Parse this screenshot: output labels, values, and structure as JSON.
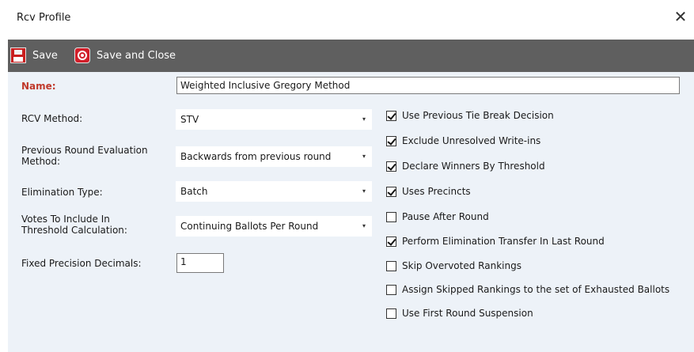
{
  "window": {
    "title": "Rcv Profile",
    "close_glyph": "✕"
  },
  "toolbar": {
    "save_label": "Save",
    "save_close_label": "Save and Close"
  },
  "form": {
    "name_label": "Name:",
    "name_value": "Weighted Inclusive Gregory Method",
    "rcv_method_label": "RCV Method:",
    "rcv_method_value": "STV",
    "prev_round_label_1": "Previous Round Evaluation",
    "prev_round_label_2": "Method:",
    "prev_round_value": "Backwards from previous round",
    "elimination_type_label": "Elimination Type:",
    "elimination_type_value": "Batch",
    "votes_label_1": "Votes To Include In",
    "votes_label_2": "Threshold Calculation:",
    "votes_value": "Continuing Ballots Per Round",
    "precision_label": "Fixed Precision Decimals:",
    "precision_value": "1"
  },
  "options": [
    {
      "label": "Use Previous Tie Break Decision",
      "checked": true
    },
    {
      "label": "Exclude Unresolved Write-ins",
      "checked": true
    },
    {
      "label": "Declare Winners By Threshold",
      "checked": true
    },
    {
      "label": "Uses Precincts",
      "checked": true
    },
    {
      "label": "Pause After Round",
      "checked": false
    },
    {
      "label": "Perform Elimination Transfer In Last Round",
      "checked": true
    },
    {
      "label": "Skip Overvoted Rankings",
      "checked": false
    },
    {
      "label": "Assign Skipped Rankings to the set of Exhausted Ballots",
      "checked": false
    },
    {
      "label": "Use First Round Suspension",
      "checked": false
    }
  ],
  "colors": {
    "toolbar_bg": "#5f5f5f",
    "panel_bg": "#edf2f8",
    "name_label": "#c0392b",
    "save_icon": "#c91f1f"
  },
  "icons": {
    "save": "floppy-disk-icon",
    "save_close": "target-icon",
    "combo_arrow": "▾"
  }
}
